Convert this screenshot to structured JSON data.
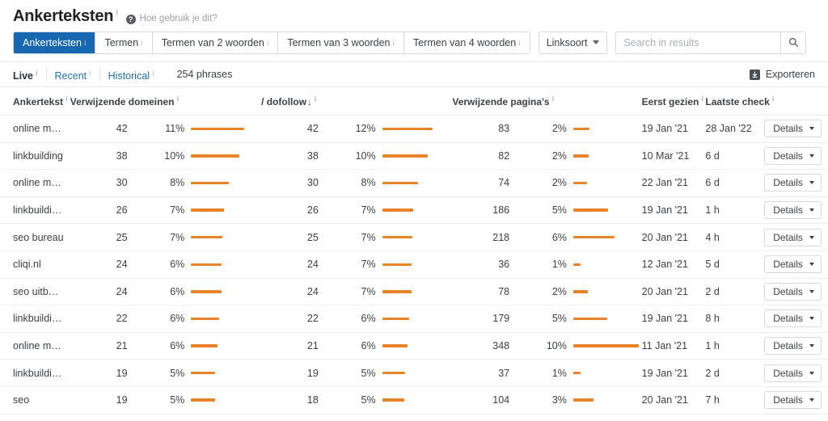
{
  "header": {
    "title": "Ankerteksten",
    "info_marker": "i",
    "help_icon": "question-circle-icon",
    "help_label": "Hoe gebruik je dit?"
  },
  "tabs": [
    {
      "label": "Ankerteksten",
      "active": true
    },
    {
      "label": "Termen",
      "active": false
    },
    {
      "label": "Termen van 2 woorden",
      "active": false
    },
    {
      "label": "Termen van 3 woorden",
      "active": false
    },
    {
      "label": "Termen van 4 woorden",
      "active": false
    }
  ],
  "filters": {
    "link_type_label": "Linksoort",
    "link_type_caret": "chevron-down-icon",
    "search_placeholder": "Search in results",
    "search_value": "",
    "search_icon": "search-icon"
  },
  "subbar": {
    "items": [
      {
        "label": "Live",
        "active": true
      },
      {
        "label": "Recent",
        "active": false
      },
      {
        "label": "Historical",
        "active": false
      }
    ],
    "phrases": "254 phrases",
    "export_label": "Exporteren",
    "export_icon": "download-icon"
  },
  "table": {
    "headers": {
      "anchor": "Ankertekst",
      "referring_domains": "Verwijzende domeinen",
      "dofollow": "/ dofollow",
      "dofollow_sort": "↓",
      "referring_pages": "Verwijzende pagina's",
      "first_seen": "Eerst gezien",
      "last_check": "Laatste check",
      "details": ""
    },
    "details_label": "Details",
    "rows": [
      {
        "anchor": "online marketing bureau",
        "rd": "42",
        "rd_pct": "11%",
        "rd_bar": 66,
        "df": "42",
        "df_pct": "12%",
        "df_bar": 62,
        "rp": "83",
        "rp_pct": "2%",
        "rp_bar": 20,
        "first_seen": "19 Jan '21",
        "last_check": "28 Jan '22"
      },
      {
        "anchor": "linkbuilding",
        "rd": "38",
        "rd_pct": "10%",
        "rd_bar": 60,
        "df": "38",
        "df_pct": "10%",
        "df_bar": 56,
        "rp": "82",
        "rp_pct": "2%",
        "rp_bar": 19,
        "first_seen": "10 Mar '21",
        "last_check": "6 d"
      },
      {
        "anchor": "online marketing uitbesteden",
        "rd": "30",
        "rd_pct": "8%",
        "rd_bar": 47,
        "df": "30",
        "df_pct": "8%",
        "df_bar": 44,
        "rp": "74",
        "rp_pct": "2%",
        "rp_bar": 17,
        "first_seen": "22 Jan '21",
        "last_check": "6 d"
      },
      {
        "anchor": "linkbuilding bureau",
        "rd": "26",
        "rd_pct": "7%",
        "rd_bar": 41,
        "df": "26",
        "df_pct": "7%",
        "df_bar": 38,
        "rp": "186",
        "rp_pct": "5%",
        "rp_bar": 43,
        "first_seen": "19 Jan '21",
        "last_check": "1 h"
      },
      {
        "anchor": "seo bureau",
        "rd": "25",
        "rd_pct": "7%",
        "rd_bar": 39,
        "df": "25",
        "df_pct": "7%",
        "df_bar": 37,
        "rp": "218",
        "rp_pct": "6%",
        "rp_bar": 51,
        "first_seen": "20 Jan '21",
        "last_check": "4 h"
      },
      {
        "anchor": "cliqi.nl",
        "rd": "24",
        "rd_pct": "6%",
        "rd_bar": 38,
        "df": "24",
        "df_pct": "7%",
        "df_bar": 36,
        "rp": "36",
        "rp_pct": "1%",
        "rp_bar": 9,
        "first_seen": "12 Jan '21",
        "last_check": "5 d"
      },
      {
        "anchor": "seo uitbesteden",
        "rd": "24",
        "rd_pct": "6%",
        "rd_bar": 38,
        "df": "24",
        "df_pct": "7%",
        "df_bar": 36,
        "rp": "78",
        "rp_pct": "2%",
        "rp_bar": 18,
        "first_seen": "20 Jan '21",
        "last_check": "2 d"
      },
      {
        "anchor": "linkbuilding uitbesteden",
        "rd": "22",
        "rd_pct": "6%",
        "rd_bar": 35,
        "df": "22",
        "df_pct": "6%",
        "df_bar": 33,
        "rp": "179",
        "rp_pct": "5%",
        "rp_bar": 42,
        "first_seen": "19 Jan '21",
        "last_check": "8 h"
      },
      {
        "anchor": "online marketing bureau cliqi",
        "rd": "21",
        "rd_pct": "6%",
        "rd_bar": 33,
        "df": "21",
        "df_pct": "6%",
        "df_bar": 31,
        "rp": "348",
        "rp_pct": "10%",
        "rp_bar": 81,
        "first_seen": "11 Jan '21",
        "last_check": "1 h"
      },
      {
        "anchor": "linkbuilding strategie",
        "rd": "19",
        "rd_pct": "5%",
        "rd_bar": 30,
        "df": "19",
        "df_pct": "5%",
        "df_bar": 28,
        "rp": "37",
        "rp_pct": "1%",
        "rp_bar": 9,
        "first_seen": "19 Jan '21",
        "last_check": "2 d"
      },
      {
        "anchor": "seo",
        "rd": "19",
        "rd_pct": "5%",
        "rd_bar": 30,
        "df": "18",
        "df_pct": "5%",
        "df_bar": 27,
        "rp": "104",
        "rp_pct": "3%",
        "rp_bar": 25,
        "first_seen": "20 Jan '21",
        "last_check": "7 h"
      }
    ]
  },
  "colors": {
    "accent_blue": "#1768b0",
    "bar_orange": "#e8832a",
    "link_blue": "#1f6fb2",
    "muted_gray": "#a4a9ae"
  }
}
